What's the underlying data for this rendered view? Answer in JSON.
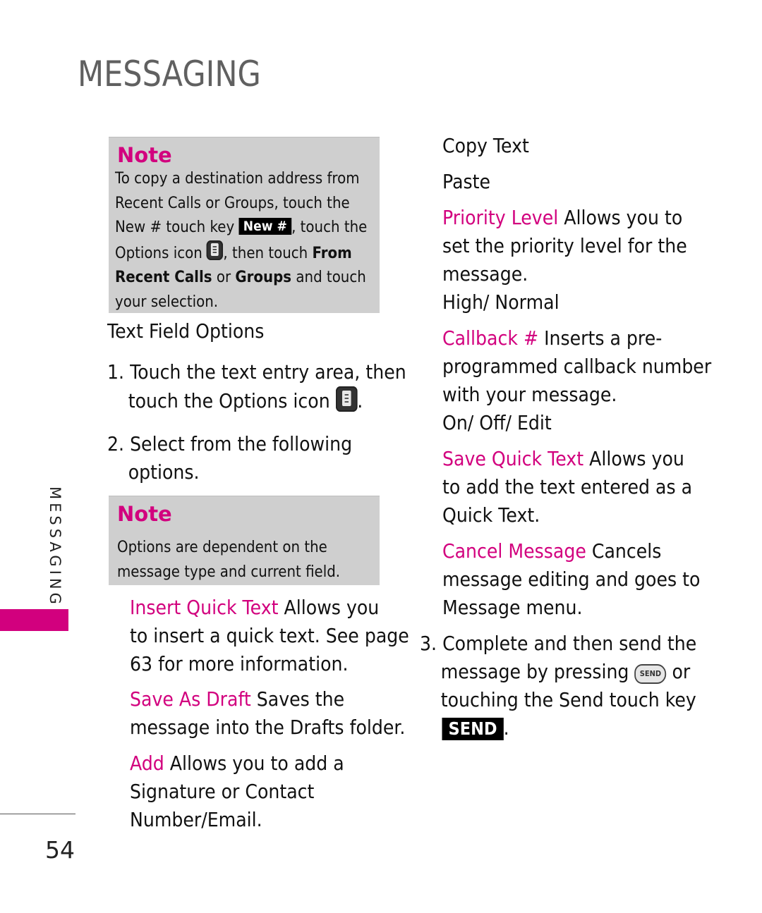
{
  "header": {
    "title": "MESSAGING"
  },
  "side_tab": {
    "label": "MESSAGING",
    "accent_color": "#d2007e"
  },
  "footer": {
    "page_number": "54"
  },
  "note1": {
    "title": "Note",
    "line1": "To copy a destination address from",
    "line2": "Recent Calls or Groups, touch the",
    "line3_a": "New # touch key ",
    "new_key_label": "New #",
    "line3_b": ", touch the",
    "line4_a": "Options icon ",
    "line4_b": ", then touch ",
    "line4_bold": "From",
    "line5_bold1": "Recent Calls",
    "line5_mid": " or ",
    "line5_bold2": "Groups",
    "line5_end": " and touch",
    "line6": "your selection."
  },
  "section": {
    "heading": "Text Field Options",
    "step1_num": "1.",
    "step1_line1": "Touch the text entry area, then",
    "step1_line2": "touch the Options icon ",
    "step1_end": ".",
    "step2_num": "2.",
    "step2_line1": "Select from the following",
    "step2_line2": "options."
  },
  "note2": {
    "title": "Note",
    "line1": "Options are dependent on the",
    "line2": "message type and current field."
  },
  "left_options": [
    {
      "term": "Insert Quick Text",
      "desc1": " Allows you",
      "desc2": "to insert a quick text. See page",
      "desc3": "63 for more information."
    },
    {
      "term": "Save As Draft",
      "desc1": "  Saves the",
      "desc2": "message into the Drafts folder."
    },
    {
      "term": "Add",
      "desc1": "  Allows you to add a",
      "desc2": "Signature or Contact",
      "desc3": "Number/Email."
    }
  ],
  "right_options": {
    "copy_text": "Copy Text",
    "paste": "Paste",
    "priority": {
      "term": "Priority Level",
      "desc1": "  Allows you to",
      "desc2": "set the priority level for the",
      "desc3": "message.",
      "values": "High/ Normal"
    },
    "callback": {
      "term": "Callback #",
      "desc1": "  Inserts a pre-",
      "desc2": "programmed callback number",
      "desc3": "with your message.",
      "values": "On/ Off/ Edit"
    },
    "save_quick": {
      "term": "Save Quick Text",
      "desc1": "  Allows you",
      "desc2": "to add the text entered as a",
      "desc3": "Quick Text."
    },
    "cancel": {
      "term": "Cancel Message",
      "desc1": "  Cancels",
      "desc2": "message editing and goes to",
      "desc3": "Message menu."
    }
  },
  "step3": {
    "num": "3.",
    "line1": "Complete and then send the",
    "line2_a": "message by pressing ",
    "send_hw_label": "SEND",
    "line2_b": " or",
    "line3": "touching the Send touch key",
    "send_key_label": "SEND",
    "end": "."
  }
}
